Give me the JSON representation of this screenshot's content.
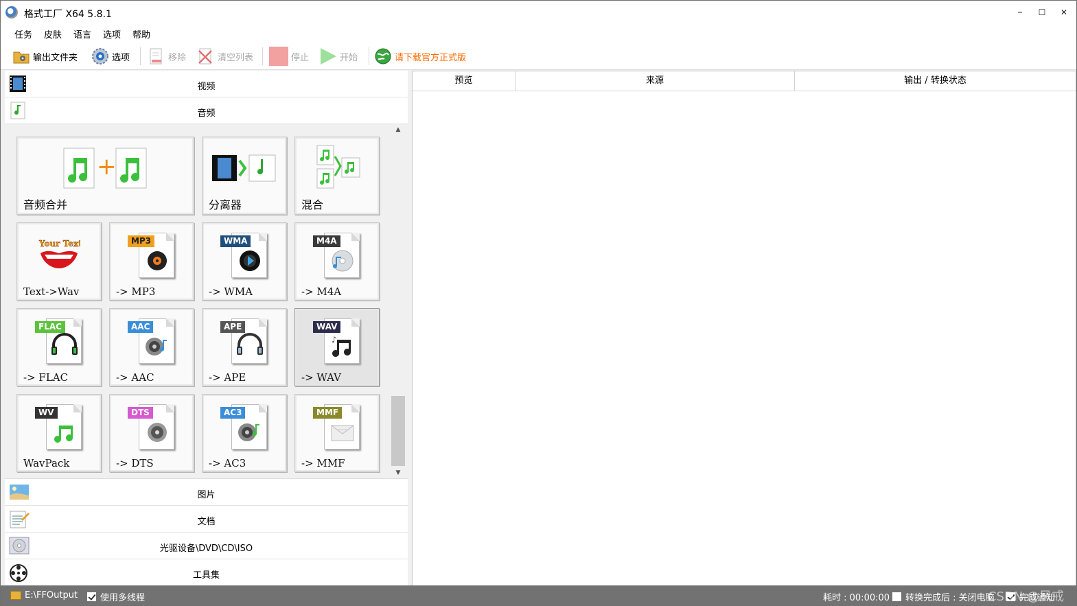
{
  "window": {
    "title": "格式工厂 X64 5.8.1",
    "minimize": "–",
    "maximize": "☐",
    "close": "✕"
  },
  "menu": [
    "任务",
    "皮肤",
    "语言",
    "选项",
    "帮助"
  ],
  "toolbar": {
    "output_folder": "输出文件夹",
    "options": "选项",
    "remove": "移除",
    "clear_list": "清空列表",
    "stop": "停止",
    "start": "开始",
    "download": "请下载官方正式版"
  },
  "categories": {
    "video": "视频",
    "audio": "音频",
    "image": "图片",
    "document": "文档",
    "disc": "光驱设备\\DVD\\CD\\ISO",
    "tools": "工具集"
  },
  "tiles": {
    "merge": "音频合并",
    "splitter": "分离器",
    "mix": "混合",
    "text_wav": {
      "label": "Text->Wav",
      "badge": "Your Text"
    },
    "mp3": {
      "label": "-> MP3",
      "badge": "MP3"
    },
    "wma": {
      "label": "-> WMA",
      "badge": "WMA"
    },
    "m4a": {
      "label": "-> M4A",
      "badge": "M4A"
    },
    "flac": {
      "label": "-> FLAC",
      "badge": "FLAC"
    },
    "aac": {
      "label": "-> AAC",
      "badge": "AAC"
    },
    "ape": {
      "label": "-> APE",
      "badge": "APE"
    },
    "wav": {
      "label": "-> WAV",
      "badge": "WAV"
    },
    "wavpack": {
      "label": "WavPack",
      "badge": "WV"
    },
    "dts": {
      "label": "-> DTS",
      "badge": "DTS"
    },
    "ac3": {
      "label": "-> AC3",
      "badge": "AC3"
    },
    "mmf": {
      "label": "-> MMF",
      "badge": "MMF"
    }
  },
  "table": {
    "columns": [
      "预览",
      "来源",
      "输出 / 转换状态"
    ]
  },
  "status": {
    "output_path": "E:\\FFOutput",
    "multithread": "使用多线程",
    "elapsed": "耗时 : 00:00:00",
    "after_done": "转换完成后 : 关闭电脑",
    "notify": "完成通知",
    "watermark": "CSDN @风戒"
  },
  "colors": {
    "mp3": "#f0a020",
    "wma": "#1f4f7a",
    "m4a": "#3a3a3a",
    "flac": "#5cc23c",
    "aac": "#3a8ed8",
    "ape": "#555555",
    "wav": "#2b2b4a",
    "wv": "#333333",
    "dts": "#d65ad0",
    "ac3": "#3a8ed8",
    "mmf": "#8a8a2a"
  }
}
